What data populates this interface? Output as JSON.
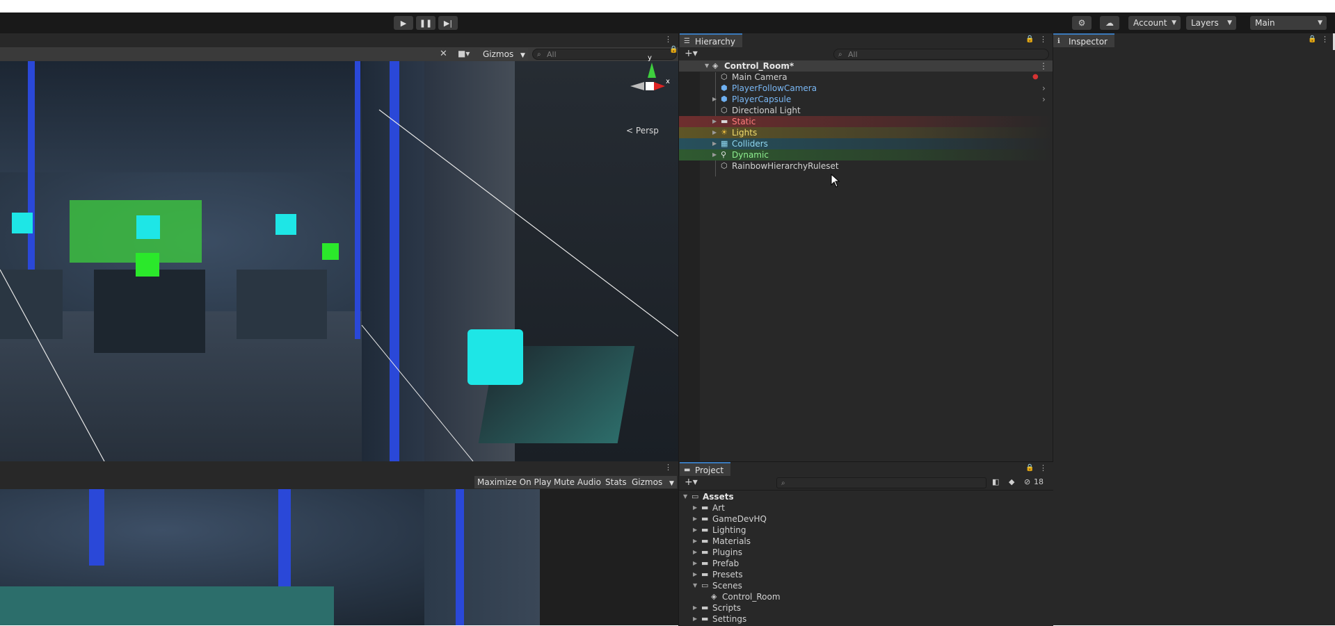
{
  "toolbar": {
    "play_icon": "play-icon",
    "pause_icon": "pause-icon",
    "step_icon": "step-icon",
    "services_icon": "services-icon",
    "cloud_icon": "cloud-icon",
    "account_label": "Account",
    "layers_label": "Layers",
    "layout_label": "Main"
  },
  "scene_view": {
    "gizmos_label": "Gizmos",
    "search_placeholder": "All",
    "persp_label": "Persp",
    "axis_y": "y",
    "axis_x": "x"
  },
  "game_view": {
    "buttons": [
      "Maximize On Play",
      "Mute Audio",
      "Stats",
      "Gizmos"
    ]
  },
  "hierarchy": {
    "tab_label": "Hierarchy",
    "search_placeholder": "All",
    "scene_name": "Control_Room*",
    "items": [
      {
        "label": "Main Camera",
        "color": "#d2d2d2"
      },
      {
        "label": "PlayerFollowCamera",
        "color": "#7ab8f5"
      },
      {
        "label": "PlayerCapsule",
        "color": "#7ab8f5"
      },
      {
        "label": "Directional Light",
        "color": "#d2d2d2"
      },
      {
        "label": "Static",
        "color": "#ff7b7b",
        "band": "#6e2e2e"
      },
      {
        "label": "Lights",
        "color": "#f3dd6d",
        "band": "#5e5526"
      },
      {
        "label": "Colliders",
        "color": "#8fd6ef",
        "band": "#27505c"
      },
      {
        "label": "Dynamic",
        "color": "#8ff08f",
        "band": "#2f5a30"
      },
      {
        "label": "RainbowHierarchyRuleset",
        "color": "#d2d2d2"
      }
    ]
  },
  "inspector": {
    "tab_label": "Inspector"
  },
  "project": {
    "tab_label": "Project",
    "hidden_count": "18",
    "root": "Assets",
    "folders": [
      "Art",
      "GameDevHQ",
      "Lighting",
      "Materials",
      "Plugins",
      "Prefab",
      "Presets",
      "Scenes",
      "Scripts",
      "Settings"
    ],
    "scene_asset": "Control_Room"
  }
}
